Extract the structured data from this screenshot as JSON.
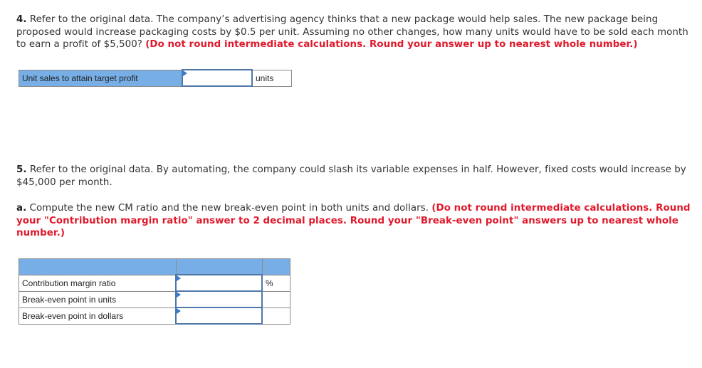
{
  "q4": {
    "number": "4.",
    "text": " Refer to the original data. The company’s advertising agency thinks that a new package would help sales. The new package being proposed would increase packaging costs by $0.5 per unit. Assuming no other changes, how many units would have to be sold each month to earn a profit of $5,500? ",
    "instruction": "(Do not round intermediate calculations. Round your answer up to nearest whole number.)",
    "table": {
      "row_label": "Unit sales to attain target profit",
      "value": "",
      "unit": "units"
    }
  },
  "q5": {
    "number": "5.",
    "text": " Refer to the original data. By automating, the company could slash its variable expenses in half. However, fixed costs would increase by $45,000 per month.",
    "part_a": {
      "letter": "a.",
      "text": " Compute the new CM ratio and the new break-even point in both units and dollars. ",
      "instruction": "(Do not round intermediate calculations. Round your \"Contribution margin ratio\" answer to 2 decimal places. Round your \"Break-even point\" answers up to nearest whole number.)"
    },
    "table": {
      "rows": [
        {
          "label": "Contribution margin ratio",
          "value": "",
          "unit": "%"
        },
        {
          "label": "Break-even point in units",
          "value": "",
          "unit": ""
        },
        {
          "label": "Break-even point in dollars",
          "value": "",
          "unit": ""
        }
      ]
    }
  },
  "colors": {
    "header_fill": "#77aee5",
    "input_border": "#4f78a8",
    "instruction_red": "#e0192b"
  }
}
